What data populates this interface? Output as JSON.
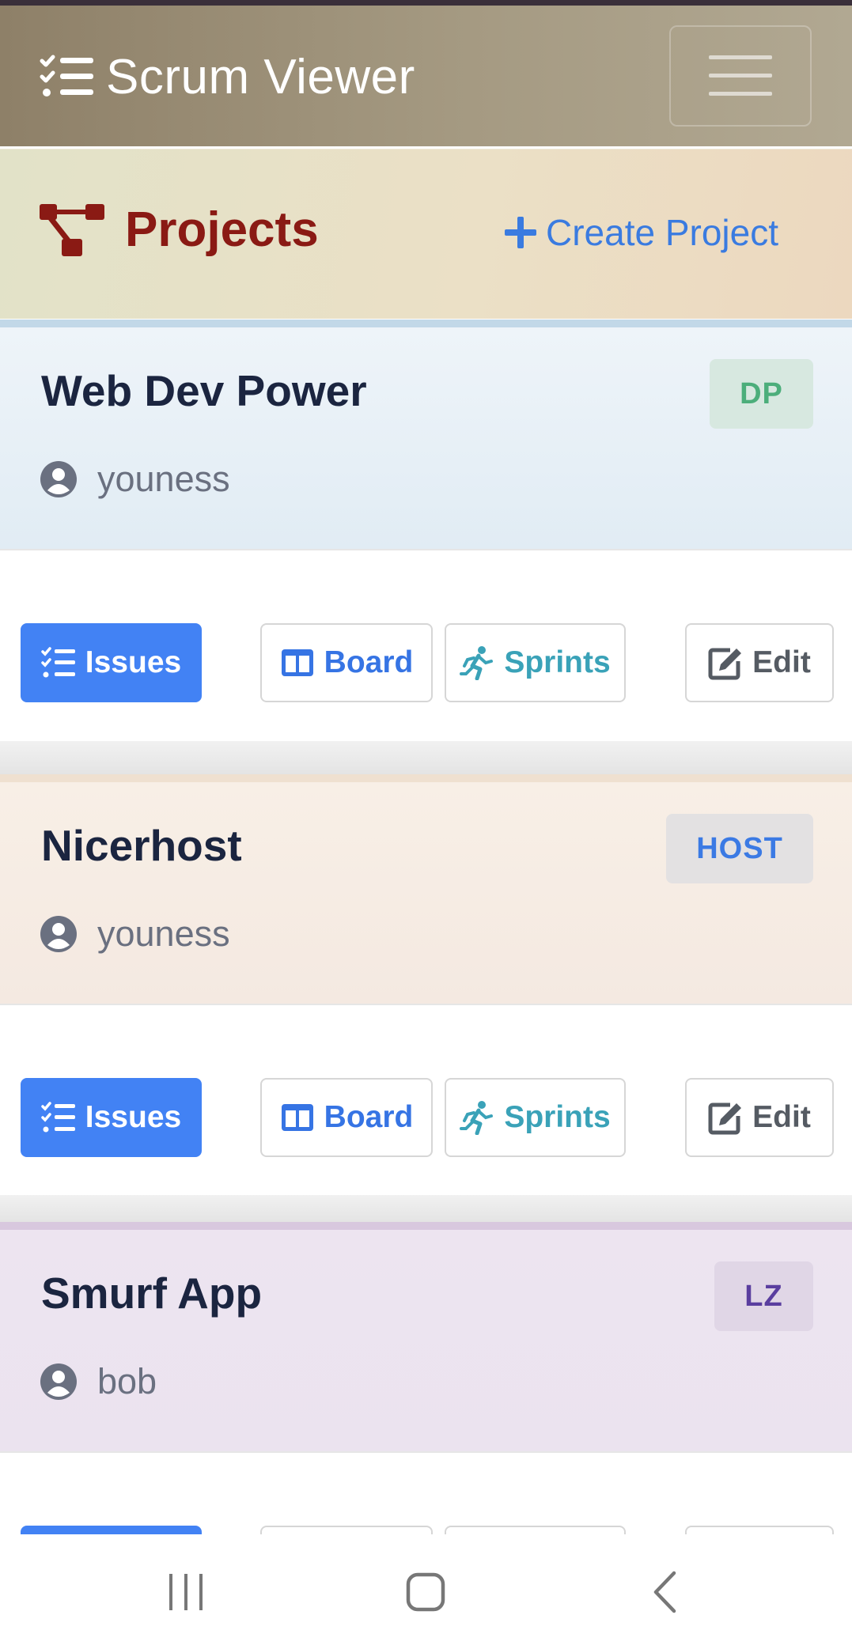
{
  "app": {
    "title": "Scrum Viewer"
  },
  "header": {
    "title": "Projects",
    "create_label": "Create Project"
  },
  "actions": {
    "issues": "Issues",
    "board": "Board",
    "sprints": "Sprints",
    "edit": "Edit"
  },
  "projects": [
    {
      "name": "Web Dev Power",
      "key": "DP",
      "owner": "youness"
    },
    {
      "name": "Nicerhost",
      "key": "HOST",
      "owner": "youness"
    },
    {
      "name": "Smurf App",
      "key": "LZ",
      "owner": "bob"
    }
  ],
  "colors": {
    "primary": "#4282f4",
    "projects_title": "#8a1a14",
    "navbar": "#a59a82"
  },
  "system_nav": {
    "icons": [
      "recent-apps-icon",
      "home-icon",
      "back-icon"
    ]
  }
}
